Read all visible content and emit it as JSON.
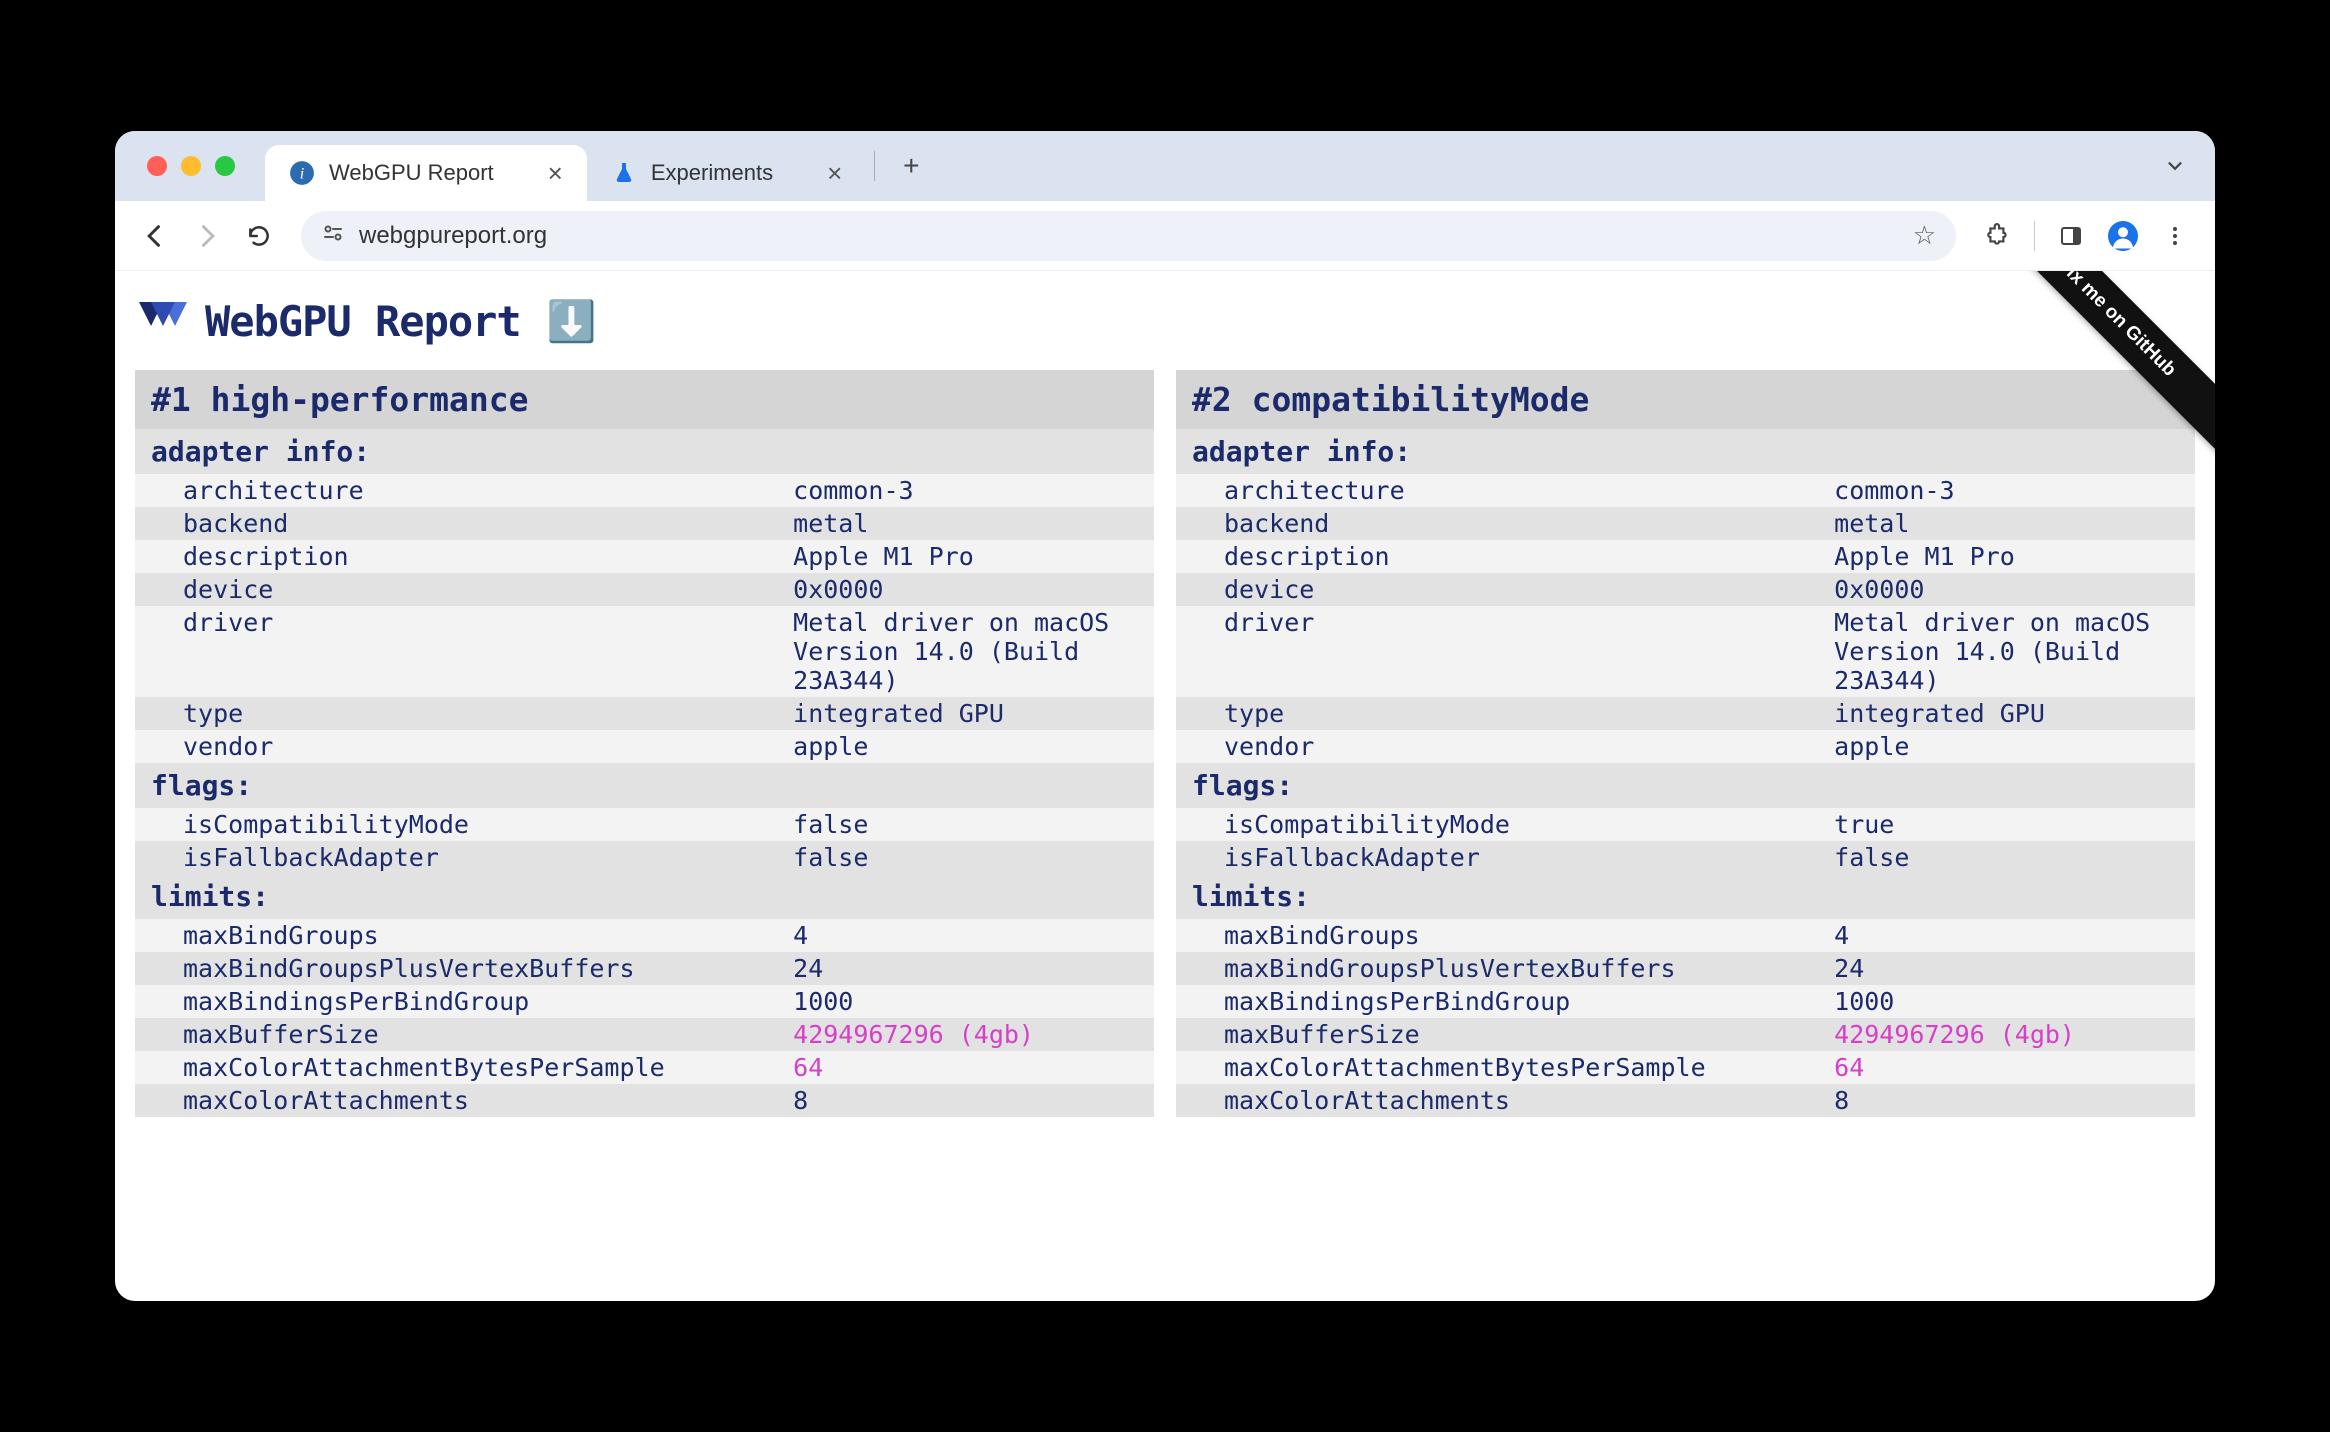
{
  "browser": {
    "tabs": [
      {
        "title": "WebGPU Report",
        "active": true
      },
      {
        "title": "Experiments",
        "active": false
      }
    ],
    "url": "webgpureport.org"
  },
  "ribbon": "Fix me on GitHub",
  "page_title": "WebGPU Report",
  "columns": [
    {
      "title": "#1 high-performance",
      "sections": [
        {
          "title": "adapter info:",
          "rows": [
            {
              "k": "architecture",
              "v": "common-3"
            },
            {
              "k": "backend",
              "v": "metal"
            },
            {
              "k": "description",
              "v": "Apple M1 Pro"
            },
            {
              "k": "device",
              "v": "0x0000"
            },
            {
              "k": "driver",
              "v": "Metal driver on macOS Version 14.0 (Build 23A344)"
            },
            {
              "k": "type",
              "v": "integrated GPU"
            },
            {
              "k": "vendor",
              "v": "apple"
            }
          ]
        },
        {
          "title": "flags:",
          "rows": [
            {
              "k": "isCompatibilityMode",
              "v": "false"
            },
            {
              "k": "isFallbackAdapter",
              "v": "false"
            }
          ]
        },
        {
          "title": "limits:",
          "rows": [
            {
              "k": "maxBindGroups",
              "v": "4"
            },
            {
              "k": "maxBindGroupsPlusVertexBuffers",
              "v": "24"
            },
            {
              "k": "maxBindingsPerBindGroup",
              "v": "1000"
            },
            {
              "k": "maxBufferSize",
              "v": "4294967296 (4gb)",
              "highlight": true
            },
            {
              "k": "maxColorAttachmentBytesPerSample",
              "v": "64",
              "highlight": true
            },
            {
              "k": "maxColorAttachments",
              "v": "8"
            }
          ]
        }
      ]
    },
    {
      "title": "#2 compatibilityMode",
      "sections": [
        {
          "title": "adapter info:",
          "rows": [
            {
              "k": "architecture",
              "v": "common-3"
            },
            {
              "k": "backend",
              "v": "metal"
            },
            {
              "k": "description",
              "v": "Apple M1 Pro"
            },
            {
              "k": "device",
              "v": "0x0000"
            },
            {
              "k": "driver",
              "v": "Metal driver on macOS Version 14.0 (Build 23A344)"
            },
            {
              "k": "type",
              "v": "integrated GPU"
            },
            {
              "k": "vendor",
              "v": "apple"
            }
          ]
        },
        {
          "title": "flags:",
          "rows": [
            {
              "k": "isCompatibilityMode",
              "v": "true"
            },
            {
              "k": "isFallbackAdapter",
              "v": "false"
            }
          ]
        },
        {
          "title": "limits:",
          "rows": [
            {
              "k": "maxBindGroups",
              "v": "4"
            },
            {
              "k": "maxBindGroupsPlusVertexBuffers",
              "v": "24"
            },
            {
              "k": "maxBindingsPerBindGroup",
              "v": "1000"
            },
            {
              "k": "maxBufferSize",
              "v": "4294967296 (4gb)",
              "highlight": true
            },
            {
              "k": "maxColorAttachmentBytesPerSample",
              "v": "64",
              "highlight": true
            },
            {
              "k": "maxColorAttachments",
              "v": "8"
            }
          ]
        }
      ]
    }
  ]
}
